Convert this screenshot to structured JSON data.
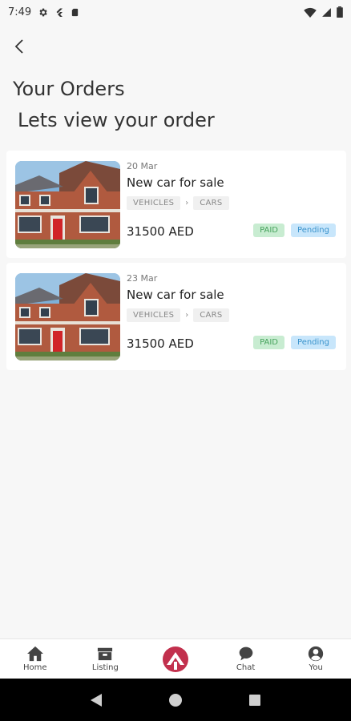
{
  "status_bar": {
    "time": "7:49",
    "left_icons": [
      "gear-icon",
      "flutter-icon",
      "sd-card-icon"
    ],
    "right_icons": [
      "wifi-icon",
      "signal-icon",
      "battery-icon"
    ]
  },
  "header": {
    "title": "Your Orders",
    "subtitle": "Lets view your order"
  },
  "orders": [
    {
      "date": "20 Mar",
      "name": "New car for sale",
      "category": "VEHICLES",
      "separator": "›",
      "subcategory": "CARS",
      "price": "31500 AED",
      "payment_status": "PAID",
      "order_status": "Pending"
    },
    {
      "date": "23 Mar",
      "name": "New car for sale",
      "category": "VEHICLES",
      "separator": "›",
      "subcategory": "CARS",
      "price": "31500 AED",
      "payment_status": "PAID",
      "order_status": "Pending"
    }
  ],
  "bottom_nav": {
    "items": [
      {
        "label": "Home",
        "icon": "home-icon"
      },
      {
        "label": "Listing",
        "icon": "listing-icon"
      },
      {
        "label": "",
        "icon": "brand-logo-icon"
      },
      {
        "label": "Chat",
        "icon": "chat-icon"
      },
      {
        "label": "You",
        "icon": "account-icon"
      }
    ]
  },
  "colors": {
    "paid_bg": "#c8ecd1",
    "paid_text": "#47a35d",
    "pending_bg": "#c8e6fb",
    "pending_text": "#3a93cc",
    "brand": "#c2304d"
  }
}
